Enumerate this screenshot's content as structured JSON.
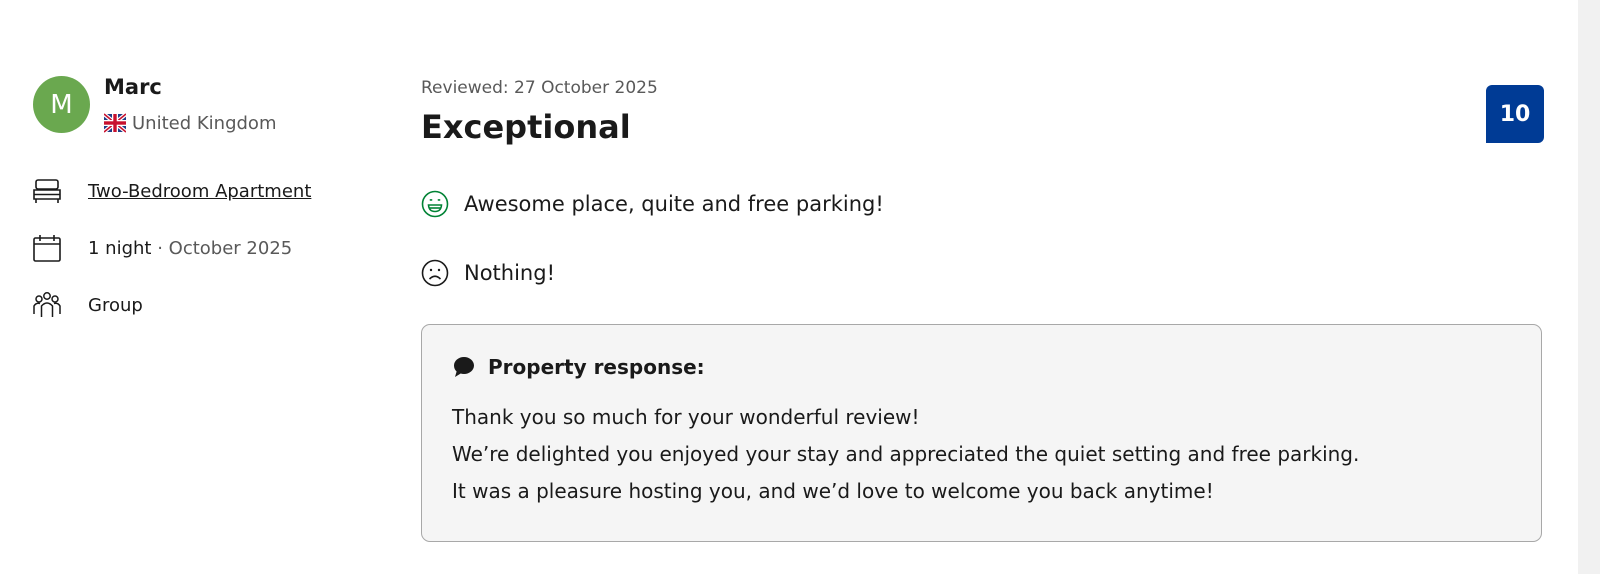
{
  "reviewer": {
    "avatar_letter": "M",
    "avatar_color": "#6aa84f",
    "name": "Marc",
    "country": "United Kingdom",
    "flag_icon": "uk-flag-icon"
  },
  "stay": {
    "room": "Two-Bedroom Apartment",
    "room_icon": "bed-icon",
    "nights": "1 night",
    "separator": " · ",
    "month": "October 2025",
    "date_icon": "calendar-icon",
    "traveler_type": "Group",
    "traveler_icon": "group-icon"
  },
  "review": {
    "reviewed_date": "Reviewed: 27 October 2025",
    "title": "Exceptional",
    "score": "10",
    "score_color": "#003b95",
    "positive": "Awesome place, quite and free parking!",
    "positive_icon": "happy-face-icon",
    "negative": "Nothing!",
    "negative_icon": "sad-face-icon"
  },
  "property_response": {
    "header": "Property response:",
    "lines": [
      "Thank you so much for your wonderful review!",
      "We’re delighted you enjoyed your stay and appreciated the quiet setting and free parking.",
      "It was a pleasure hosting you, and we’d love to welcome you back anytime!"
    ]
  }
}
